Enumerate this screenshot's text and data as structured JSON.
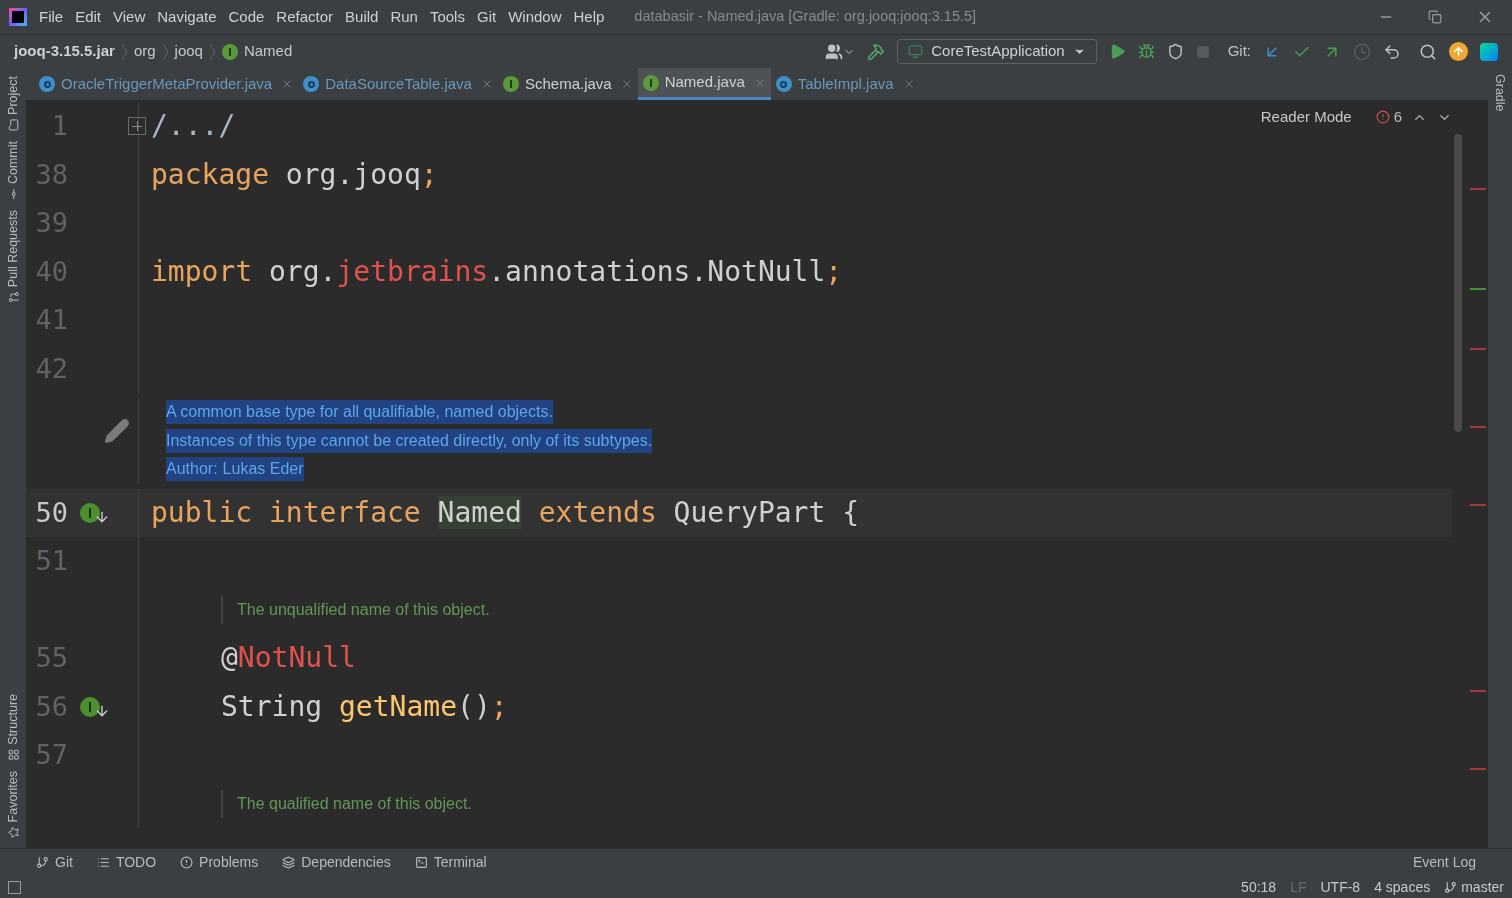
{
  "menu": [
    "File",
    "Edit",
    "View",
    "Navigate",
    "Code",
    "Refactor",
    "Build",
    "Run",
    "Tools",
    "Git",
    "Window",
    "Help"
  ],
  "window": {
    "title": "databasir - Named.java [Gradle: org.jooq:jooq:3.15.5]"
  },
  "breadcrumbs": [
    {
      "label": "jooq-3.15.5.jar",
      "kind": "jar"
    },
    {
      "label": "org",
      "kind": "package"
    },
    {
      "label": "jooq",
      "kind": "package"
    },
    {
      "label": "Named",
      "kind": "interface"
    }
  ],
  "run_config": "CoreTestApplication",
  "git_label": "Git:",
  "tabs": [
    {
      "label": "OracleTriggerMetaProvider.java",
      "kind": "class",
      "selected": false
    },
    {
      "label": "DataSourceTable.java",
      "kind": "class",
      "selected": false
    },
    {
      "label": "Schema.java",
      "kind": "interface",
      "selected": false
    },
    {
      "label": "Named.java",
      "kind": "interface",
      "selected": true
    },
    {
      "label": "TableImpl.java",
      "kind": "class",
      "selected": false
    }
  ],
  "left_tools": [
    "Project",
    "Commit",
    "Pull Requests",
    "Structure",
    "Favorites"
  ],
  "right_tools": [
    "Gradle"
  ],
  "reader_mode": "Reader Mode",
  "problems_count": "6",
  "lines": [
    {
      "kind": "code",
      "number": "1",
      "current": false,
      "folded": true,
      "implemented": false,
      "tokens": [
        {
          "t": "/.../",
          "kind": "fold"
        }
      ]
    },
    {
      "kind": "code",
      "number": "38",
      "current": false,
      "implemented": false,
      "tokens": [
        {
          "t": "package",
          "kind": "keyword"
        },
        {
          "t": " org.jooq",
          "kind": "plain"
        },
        {
          "t": ";",
          "kind": "keyword"
        }
      ]
    },
    {
      "kind": "code",
      "number": "39",
      "current": false,
      "implemented": false
    },
    {
      "kind": "code",
      "number": "40",
      "current": false,
      "implemented": false,
      "tokens": [
        {
          "t": "import",
          "kind": "keyword"
        },
        {
          "t": " org.",
          "kind": "plain"
        },
        {
          "t": "jetbrains",
          "kind": "error"
        },
        {
          "t": ".annotations.NotNull",
          "kind": "plain"
        },
        {
          "t": ";",
          "kind": "keyword"
        }
      ]
    },
    {
      "kind": "code",
      "number": "41",
      "current": false,
      "implemented": false
    },
    {
      "kind": "code",
      "number": "42",
      "current": false,
      "implemented": false
    },
    {
      "kind": "doc",
      "selected": true,
      "lines": [
        {
          "text": "A common base type for all qualifiable, named objects."
        },
        {
          "text": "Instances of this type cannot be created directly, only of its subtypes."
        },
        {
          "text": "Author:",
          "link": "Lukas Eder"
        }
      ]
    },
    {
      "kind": "code",
      "number": "50",
      "current": true,
      "implemented": true,
      "tokens": [
        {
          "t": "public",
          "kind": "keyword"
        },
        {
          "t": " interface ",
          "kind": "keyword"
        },
        {
          "t": "Named",
          "kind": "usage"
        },
        {
          "t": " extends",
          "kind": "keyword"
        },
        {
          "t": " QueryPart {",
          "kind": "plain"
        }
      ],
      "children": [
        {
          "kind": "code",
          "number": "51",
          "current": false,
          "implemented": false
        },
        {
          "kind": "doc",
          "selected": false,
          "lines": [
            {
              "text": "The unqualified name of this object."
            }
          ]
        },
        {
          "kind": "code",
          "number": "55",
          "current": false,
          "implemented": false,
          "tokens": [
            {
              "t": "@",
              "kind": "plain"
            },
            {
              "t": "NotNull",
              "kind": "error"
            }
          ]
        },
        {
          "kind": "code",
          "number": "56",
          "current": false,
          "implemented": true,
          "tokens": [
            {
              "t": "String ",
              "kind": "plain"
            },
            {
              "t": "getName",
              "kind": "method"
            },
            {
              "t": "()",
              "kind": "plain"
            },
            {
              "t": ";",
              "kind": "keyword"
            }
          ]
        },
        {
          "kind": "code",
          "number": "57",
          "current": false,
          "implemented": false
        },
        {
          "kind": "doc",
          "selected": false,
          "lines": [
            {
              "text": "The qualified name of this object."
            }
          ]
        }
      ]
    }
  ],
  "tool_tabs": [
    {
      "label": "Git",
      "kind": "branch"
    },
    {
      "label": "TODO",
      "kind": "list"
    },
    {
      "label": "Problems",
      "kind": "problems"
    },
    {
      "label": "Dependencies",
      "kind": "layers"
    },
    {
      "label": "Terminal",
      "kind": "terminal"
    }
  ],
  "event_log": "Event Log",
  "status_bar": [
    {
      "label": "50:18",
      "kind": "text"
    },
    {
      "label": "LF",
      "kind": "dim"
    },
    {
      "label": "UTF-8",
      "kind": "text"
    },
    {
      "label": "4 spaces",
      "kind": "text"
    },
    {
      "label": "master",
      "kind": "branch"
    }
  ]
}
